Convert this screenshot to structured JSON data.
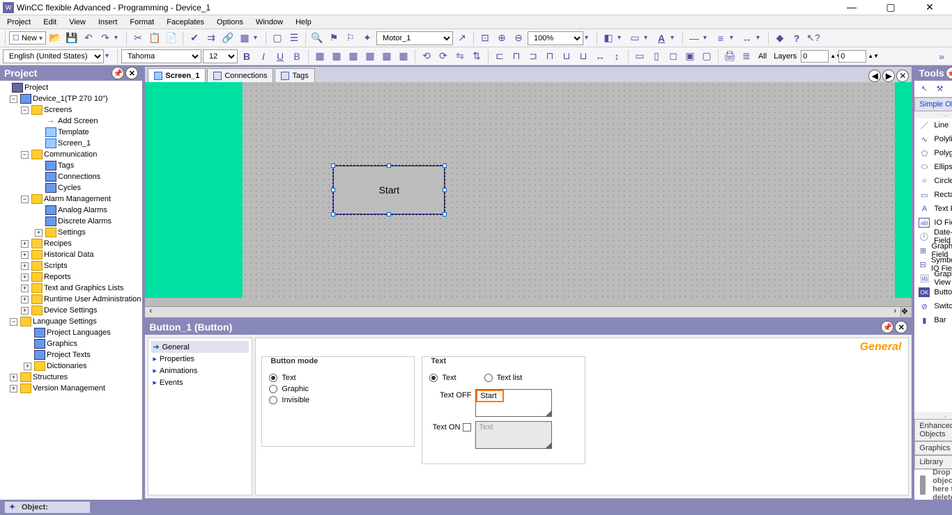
{
  "titlebar": "WinCC flexible Advanced - Programming - Device_1",
  "menu": [
    "Project",
    "Edit",
    "View",
    "Insert",
    "Format",
    "Faceplates",
    "Options",
    "Window",
    "Help"
  ],
  "toolbar1": {
    "new_label": "New",
    "combo": "Motor_1",
    "zoom": "100%"
  },
  "toolbar2": {
    "lang": "English (United States)",
    "font": "Tahoma",
    "size": "12",
    "layers_label": "Layers",
    "all_label": "All",
    "num1": "0",
    "num2": "0"
  },
  "project_panel": {
    "title": "Project"
  },
  "tree": {
    "root": "Project",
    "device": "Device_1(TP 270 10\")",
    "screens": "Screens",
    "add_screen": "Add Screen",
    "template": "Template",
    "screen_1": "Screen_1",
    "communication": "Communication",
    "tags": "Tags",
    "connections": "Connections",
    "cycles": "Cycles",
    "alarm_mgmt": "Alarm Management",
    "analog_alarms": "Analog Alarms",
    "discrete_alarms": "Discrete Alarms",
    "settings": "Settings",
    "recipes": "Recipes",
    "historical": "Historical Data",
    "scripts": "Scripts",
    "reports": "Reports",
    "text_gfx": "Text and Graphics Lists",
    "runtime_ua": "Runtime User Administration",
    "device_settings": "Device Settings",
    "lang_settings": "Language Settings",
    "proj_langs": "Project Languages",
    "graphics": "Graphics",
    "proj_texts": "Project Texts",
    "dictionaries": "Dictionaries",
    "structures": "Structures",
    "version_mgmt": "Version Management"
  },
  "editor_tabs": {
    "t1": "Screen_1",
    "t2": "Connections",
    "t3": "Tags"
  },
  "canvas": {
    "start_button": "Start"
  },
  "prop": {
    "title": "Button_1 (Button)",
    "nav": [
      "General",
      "Properties",
      "Animations",
      "Events"
    ],
    "section_title": "General",
    "button_mode": "Button mode",
    "mode_text": "Text",
    "mode_graphic": "Graphic",
    "mode_invisible": "Invisible",
    "text_section": "Text",
    "text_opt": "Text",
    "textlist_opt": "Text list",
    "text_off": "Text OFF",
    "text_off_val": "Start",
    "text_on": "Text ON",
    "text_on_placeholder": "Text"
  },
  "tools": {
    "title": "Tools",
    "cat_simple": "Simple Objects",
    "items": [
      "Line",
      "Polyline",
      "Polygon",
      "Ellipse",
      "Circle",
      "Rectangle",
      "Text Field",
      "IO Field",
      "Date-Time Field",
      "Graphic IO Field",
      "Symbolic IO Field",
      "Graphics View",
      "Button",
      "Switch",
      "Bar"
    ],
    "cat_enhanced": "Enhanced Objects",
    "cat_graphics": "Graphics",
    "cat_library": "Library",
    "drop_text": "Drop any object here to delete it."
  },
  "statusbar": {
    "object": "Object:"
  }
}
